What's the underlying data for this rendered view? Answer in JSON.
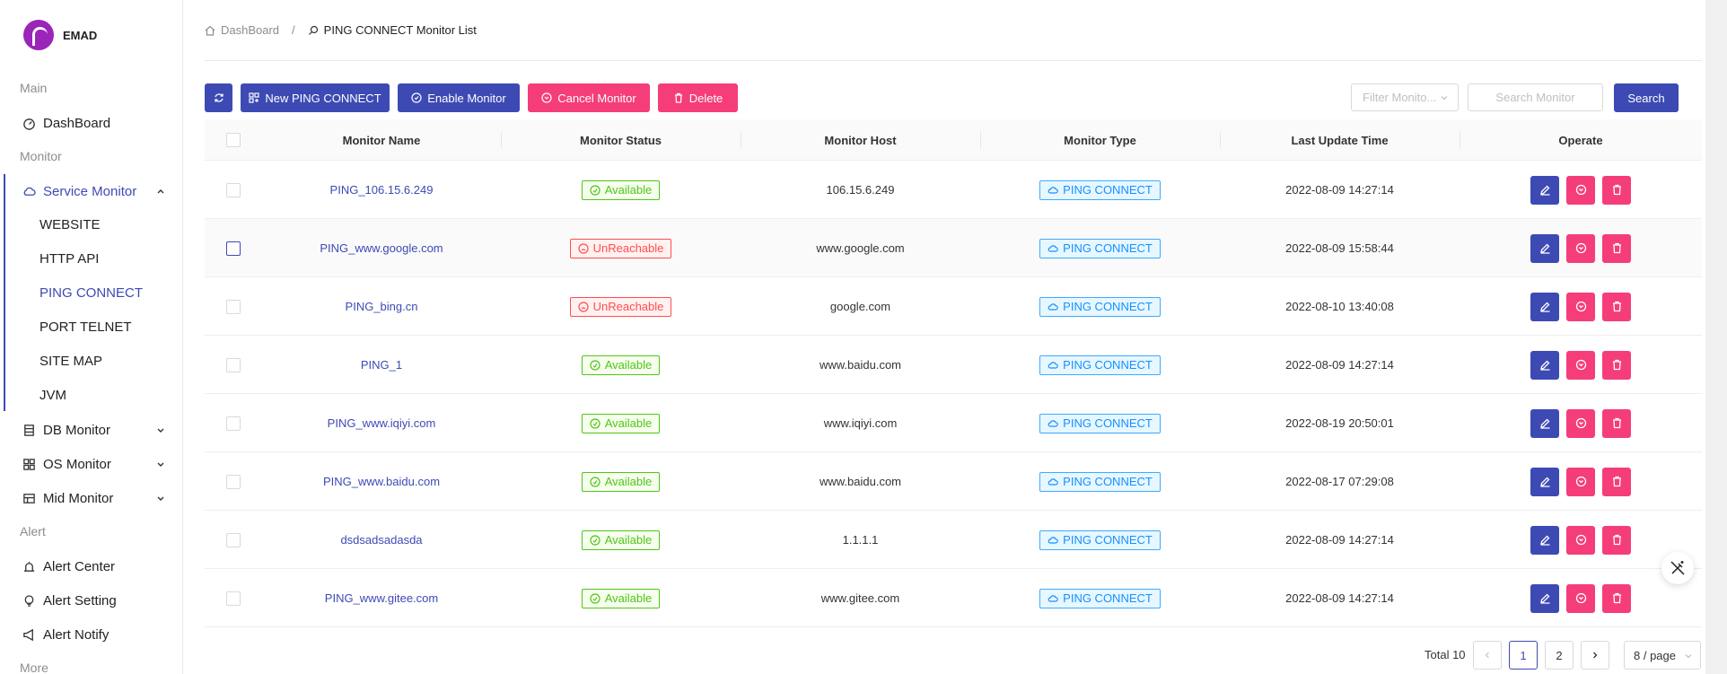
{
  "app": {
    "name": "EMAD"
  },
  "sidebar": {
    "groups": {
      "main": "Main",
      "monitor": "Monitor",
      "alert": "Alert",
      "more": "More"
    },
    "items": {
      "dashboard": "DashBoard",
      "service_monitor": "Service Monitor",
      "db_monitor": "DB Monitor",
      "os_monitor": "OS Monitor",
      "mid_monitor": "Mid Monitor",
      "alert_center": "Alert Center",
      "alert_setting": "Alert Setting",
      "alert_notify": "Alert Notify"
    },
    "sub_items": [
      "WEBSITE",
      "HTTP API",
      "PING CONNECT",
      "PORT TELNET",
      "SITE MAP",
      "JVM"
    ],
    "active_sub": "PING CONNECT"
  },
  "breadcrumb": {
    "home": "DashBoard",
    "separator": "/",
    "current": "PING CONNECT Monitor List"
  },
  "toolbar": {
    "new_label": "New PING CONNECT",
    "enable_label": "Enable Monitor",
    "cancel_label": "Cancel Monitor",
    "delete_label": "Delete",
    "filter_placeholder": "Filter Monito...",
    "search_placeholder": "Search Monitor",
    "search_label": "Search"
  },
  "colors": {
    "primary": "#3d4ab4",
    "danger": "#f53d7a",
    "available": "#52c41a",
    "unreachable": "#ff4d4f",
    "type": "#1890ff"
  },
  "table": {
    "headers": [
      "Monitor Name",
      "Monitor Status",
      "Monitor Host",
      "Monitor Type",
      "Last Update Time",
      "Operate"
    ],
    "rows": [
      {
        "name": "PING_106.15.6.249",
        "status": "Available",
        "host": "106.15.6.249",
        "type": "PING CONNECT",
        "time": "2022-08-09 14:27:14"
      },
      {
        "name": "PING_www.google.com",
        "status": "UnReachable",
        "host": "www.google.com",
        "type": "PING CONNECT",
        "time": "2022-08-09 15:58:44"
      },
      {
        "name": "PING_bing.cn",
        "status": "UnReachable",
        "host": "google.com",
        "type": "PING CONNECT",
        "time": "2022-08-10 13:40:08"
      },
      {
        "name": "PING_1",
        "status": "Available",
        "host": "www.baidu.com",
        "type": "PING CONNECT",
        "time": "2022-08-09 14:27:14"
      },
      {
        "name": "PING_www.iqiyi.com",
        "status": "Available",
        "host": "www.iqiyi.com",
        "type": "PING CONNECT",
        "time": "2022-08-19 20:50:01"
      },
      {
        "name": "PING_www.baidu.com",
        "status": "Available",
        "host": "www.baidu.com",
        "type": "PING CONNECT",
        "time": "2022-08-17 07:29:08"
      },
      {
        "name": "dsdsadsadasda",
        "status": "Available",
        "host": "1.1.1.1",
        "type": "PING CONNECT",
        "time": "2022-08-09 14:27:14"
      },
      {
        "name": "PING_www.gitee.com",
        "status": "Available",
        "host": "www.gitee.com",
        "type": "PING CONNECT",
        "time": "2022-08-09 14:27:14"
      }
    ]
  },
  "pagination": {
    "total_label": "Total 10",
    "pages": [
      "1",
      "2"
    ],
    "current": "1",
    "page_size": "8 / page"
  }
}
